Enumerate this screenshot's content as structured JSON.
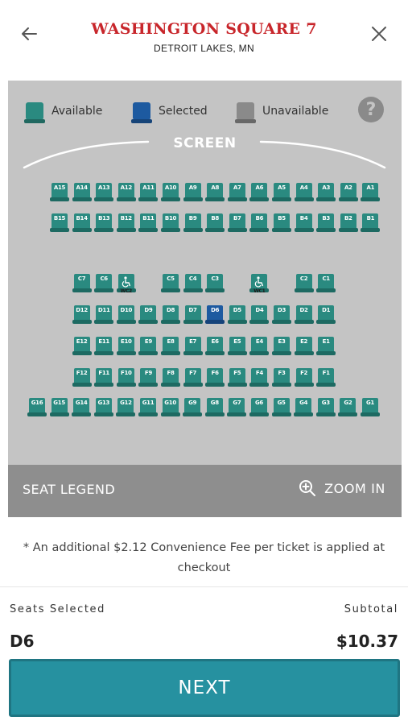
{
  "header": {
    "title": "WASHINGTON SQUARE 7",
    "subtitle": "DETROIT LAKES, MN",
    "back_icon": "arrow-left-icon",
    "close_icon": "close-icon"
  },
  "legend": {
    "available": "Available",
    "selected": "Selected",
    "unavailable": "Unavailable",
    "help": "?"
  },
  "colors": {
    "available": "#2a8a80",
    "selected": "#1d5aa0",
    "unavailable": "#8a8a8a",
    "title": "#c8262b",
    "next_button": "#2691a0"
  },
  "screen_label": "SCREEN",
  "rows": [
    {
      "row": "A",
      "seats": [
        "A15",
        "A14",
        "A13",
        "A12",
        "A11",
        "A10",
        "A9",
        "A8",
        "A7",
        "A6",
        "A5",
        "A4",
        "A3",
        "A2",
        "A1"
      ]
    },
    {
      "row": "B",
      "seats": [
        "B15",
        "B14",
        "B13",
        "B12",
        "B11",
        "B10",
        "B9",
        "B8",
        "B7",
        "B6",
        "B5",
        "B4",
        "B3",
        "B2",
        "B1"
      ]
    },
    {
      "row": "C",
      "seats": [
        "C7",
        "C6",
        "WC2",
        "",
        "C5",
        "C4",
        "C3",
        "",
        "WC1",
        "",
        "C2",
        "C1"
      ]
    },
    {
      "row": "D",
      "seats": [
        "D12",
        "D11",
        "D10",
        "D9",
        "D8",
        "D7",
        "D6",
        "D5",
        "D4",
        "D3",
        "D2",
        "D1"
      ]
    },
    {
      "row": "E",
      "seats": [
        "E12",
        "E11",
        "E10",
        "E9",
        "E8",
        "E7",
        "E6",
        "E5",
        "E4",
        "E3",
        "E2",
        "E1"
      ]
    },
    {
      "row": "F",
      "seats": [
        "F12",
        "F11",
        "F10",
        "F9",
        "F8",
        "F7",
        "F6",
        "F5",
        "F4",
        "F3",
        "F2",
        "F1"
      ]
    },
    {
      "row": "G",
      "seats": [
        "G16",
        "G15",
        "G14",
        "G13",
        "G12",
        "G11",
        "G10",
        "G9",
        "G8",
        "G7",
        "G6",
        "G5",
        "G4",
        "G3",
        "G2",
        "G1"
      ]
    }
  ],
  "selected_seat": "D6",
  "map_footer": {
    "seat_legend": "SEAT LEGEND",
    "zoom_in": "ZOOM IN"
  },
  "fee_note": "* An additional $2.12 Convenience Fee per ticket is applied at checkout",
  "summary": {
    "seats_selected_label": "Seats Selected",
    "seats_selected_value": "D6",
    "subtotal_label": "Subtotal",
    "subtotal_value": "$10.37"
  },
  "next_button": "NEXT"
}
